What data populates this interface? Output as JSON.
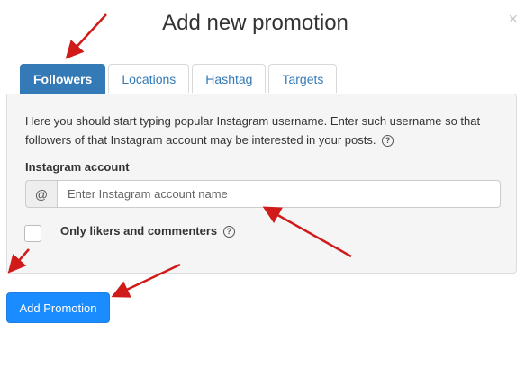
{
  "modal": {
    "title": "Add new promotion",
    "close_icon": "close-icon",
    "close_glyph": "×"
  },
  "tabs": [
    {
      "label": "Followers",
      "active": true
    },
    {
      "label": "Locations",
      "active": false
    },
    {
      "label": "Hashtag",
      "active": false
    },
    {
      "label": "Targets",
      "active": false
    }
  ],
  "panel": {
    "description": "Here you should start typing popular Instagram username. Enter such username so that followers of that Instagram account may be interested in your posts.",
    "help_icon": "help-circle-icon",
    "help_glyph": "?",
    "field_label": "Instagram account",
    "input_addon": "@",
    "input_placeholder": "Enter Instagram account name",
    "input_value": "",
    "checkbox_label": "Only likers and commenters",
    "checkbox_checked": false
  },
  "actions": {
    "add_label": "Add Promotion"
  },
  "colors": {
    "accent": "#337ab7",
    "primary_button": "#1a8cff",
    "annotation_arrow": "#d11a1a"
  }
}
